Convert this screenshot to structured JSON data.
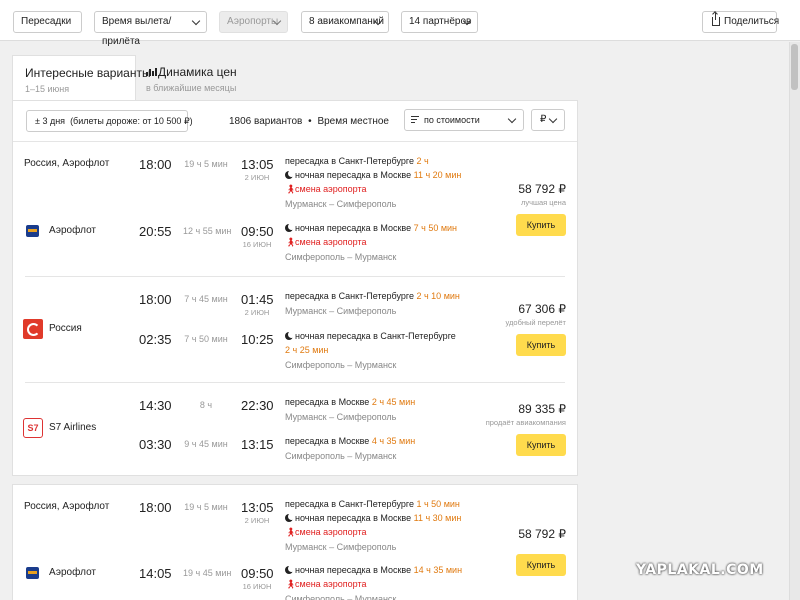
{
  "toolbar": {
    "dropdowns": [
      {
        "label": "Пересадки"
      },
      {
        "label": "Время вылета/прилёта"
      },
      {
        "label": "Аэропорты"
      },
      {
        "label": "8 авиакомпаний"
      },
      {
        "label": "14 партнёров"
      }
    ],
    "share_label": "Поделиться"
  },
  "tabs": [
    {
      "title": "Интересные варианты",
      "subtitle": "1–15 июня"
    },
    {
      "title": "Динамика цен",
      "subtitle": "в ближайшие месяцы"
    }
  ],
  "results_header": {
    "flex_filter": "± 3 дня",
    "flex_note": "(билеты дороже: от 10 500 ₽)",
    "count": "1806 вариантов",
    "bullet": "•",
    "time_note": "Время местное",
    "sort_label": "по стоимости",
    "currency": "₽"
  },
  "cards": [
    {
      "carrier_label": "Россия, Аэрофлот",
      "airline": "Аэрофлот",
      "logo": "aeroflot-logo",
      "price": "58 792 ₽",
      "price_note": "лучшая цена",
      "buy_label": "Купить",
      "outbound": {
        "dep": "18:00",
        "duration": "19 ч 5 мин",
        "arr": "13:05",
        "arr_date": "2 ИЮН",
        "lines": [
          {
            "icon": "",
            "text": "пересадка в Санкт-Петербурге",
            "suffix": "2 ч",
            "style": "normal"
          },
          {
            "icon": "moon-icon",
            "text": "ночная пересадка в Москве",
            "suffix": "11 ч 20 мин",
            "style": "normal"
          },
          {
            "icon": "walk-icon",
            "text": "смена аэропорта",
            "suffix": "",
            "style": "red"
          }
        ],
        "route": "Мурманск – Симферополь"
      },
      "inbound": {
        "dep": "20:55",
        "duration": "12 ч 55 мин",
        "arr": "09:50",
        "arr_date": "16 ИЮН",
        "lines": [
          {
            "icon": "moon-icon",
            "text": "ночная пересадка в Москве",
            "suffix": "7 ч 50 мин",
            "style": "normal"
          },
          {
            "icon": "walk-icon",
            "text": "смена аэропорта",
            "suffix": "",
            "style": "red"
          }
        ],
        "route": "Симферополь – Мурманск"
      }
    },
    {
      "carrier_label": "",
      "airline": "Россия",
      "logo": "rossiya-logo",
      "price": "67 306 ₽",
      "price_note": "удобный перелёт",
      "buy_label": "Купить",
      "outbound": {
        "dep": "18:00",
        "duration": "7 ч 45 мин",
        "arr": "01:45",
        "arr_date": "2 ИЮН",
        "lines": [
          {
            "icon": "",
            "text": "пересадка в Санкт-Петербурге",
            "suffix": "2 ч 10 мин",
            "style": "normal"
          }
        ],
        "route": "Мурманск – Симферополь"
      },
      "inbound": {
        "dep": "02:35",
        "duration": "7 ч 50 мин",
        "arr": "10:25",
        "arr_date": "",
        "lines": [
          {
            "icon": "moon-icon",
            "text": "ночная пересадка в Санкт-Петербурге",
            "suffix": "",
            "style": "normal"
          },
          {
            "icon": "",
            "text": "",
            "suffix": "2 ч 25 мин",
            "style": "normal"
          }
        ],
        "route": "Симферополь – Мурманск"
      }
    },
    {
      "carrier_label": "",
      "airline": "S7 Airlines",
      "logo": "s7-logo",
      "logo_text": "S7",
      "price": "89 335 ₽",
      "price_note": "продаёт авиакомпания",
      "buy_label": "Купить",
      "outbound": {
        "dep": "14:30",
        "duration": "8 ч",
        "arr": "22:30",
        "arr_date": "",
        "lines": [
          {
            "icon": "",
            "text": "пересадка в Москве",
            "suffix": "2 ч 45 мин",
            "style": "normal"
          }
        ],
        "route": "Мурманск – Симферополь"
      },
      "inbound": {
        "dep": "03:30",
        "duration": "9 ч 45 мин",
        "arr": "13:15",
        "arr_date": "",
        "lines": [
          {
            "icon": "",
            "text": "пересадка в Москве",
            "suffix": "4 ч 35 мин",
            "style": "normal"
          }
        ],
        "route": "Симферополь – Мурманск"
      }
    },
    {
      "carrier_label": "Россия, Аэрофлот",
      "airline": "Аэрофлот",
      "logo": "aeroflot-logo",
      "price": "58 792 ₽",
      "price_note": "",
      "buy_label": "Купить",
      "outbound": {
        "dep": "18:00",
        "duration": "19 ч 5 мин",
        "arr": "13:05",
        "arr_date": "2 ИЮН",
        "lines": [
          {
            "icon": "",
            "text": "пересадка в Санкт-Петербурге",
            "suffix": "1 ч 50 мин",
            "style": "normal"
          },
          {
            "icon": "moon-icon",
            "text": "ночная пересадка в Москве",
            "suffix": "11 ч 30 мин",
            "style": "normal"
          },
          {
            "icon": "walk-icon",
            "text": "смена аэропорта",
            "suffix": "",
            "style": "red"
          }
        ],
        "route": "Мурманск – Симферополь"
      },
      "inbound": {
        "dep": "14:05",
        "duration": "19 ч 45 мин",
        "arr": "09:50",
        "arr_date": "16 ИЮН",
        "lines": [
          {
            "icon": "moon-icon",
            "text": "ночная пересадка в Москве",
            "suffix": "14 ч 35 мин",
            "style": "normal"
          },
          {
            "icon": "walk-icon",
            "text": "смена аэропорта",
            "suffix": "",
            "style": "red"
          }
        ],
        "route": "Симферополь – Мурманск"
      }
    }
  ],
  "watermark": "YAPLAKAL.COM"
}
